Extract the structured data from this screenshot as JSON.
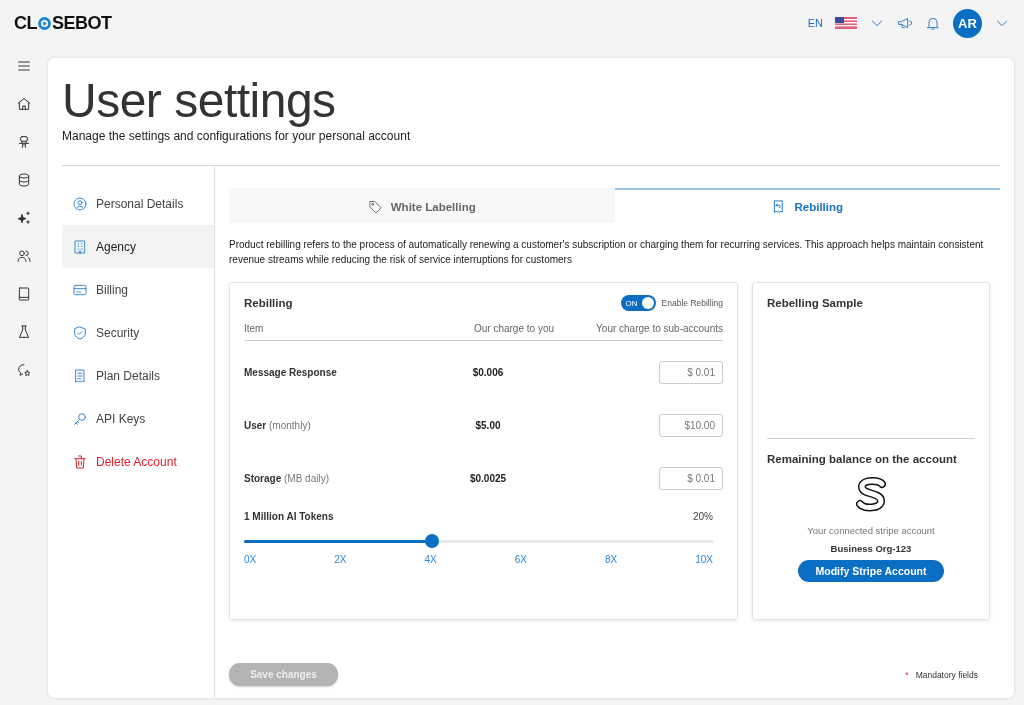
{
  "header": {
    "logo": {
      "left": "CL",
      "right": "SEBOT"
    },
    "language": "EN",
    "avatar": "AR"
  },
  "page": {
    "title": "User settings",
    "subtitle": "Manage the settings and configurations for your personal account"
  },
  "nav": [
    {
      "label": "Personal Details",
      "selected": false,
      "kind": "normal"
    },
    {
      "label": "Agency",
      "selected": true,
      "kind": "normal"
    },
    {
      "label": "Billing",
      "selected": false,
      "kind": "normal"
    },
    {
      "label": "Security",
      "selected": false,
      "kind": "normal"
    },
    {
      "label": "Plan Details",
      "selected": false,
      "kind": "normal"
    },
    {
      "label": "API Keys",
      "selected": false,
      "kind": "normal"
    },
    {
      "label": "Delete Account",
      "selected": false,
      "kind": "danger"
    }
  ],
  "tabs": [
    {
      "label": "White Labelling",
      "selected": false
    },
    {
      "label": "Rebilling",
      "selected": true
    }
  ],
  "description": "Product rebilling refers to the process of automatically renewing a customer's subscription or charging them for recurring services. This approach helps maintain consistent revenue streams while reducing the risk of service interruptions for customers",
  "rebilling": {
    "title": "Rebilling",
    "toggle": {
      "on": true,
      "text": "ON",
      "label": "Enable Rebilling"
    },
    "columns": [
      "Item",
      "Our charge to you",
      "Your charge to sub-accounts"
    ],
    "rows": [
      {
        "name": "Message Response",
        "our_charge": "$0.006",
        "your_charge": "$ 0.01"
      },
      {
        "name": "User",
        "unit": "(monthly)",
        "our_charge": "$5.00",
        "your_charge": "$10.00"
      },
      {
        "name": "Storage",
        "unit": "(MB daily)",
        "our_charge": "$0.0025",
        "your_charge": "$ 0.01"
      }
    ],
    "tokens": {
      "label": "1 Million AI Tokens",
      "reading": "20%",
      "level": 0.4,
      "ticks": [
        "0X",
        "2X",
        "4X",
        "6X",
        "8X",
        "10X"
      ]
    }
  },
  "sample": {
    "title": "Rebelling Sample",
    "balance_title": "Remaining balance on the account",
    "stripe_caption": "Your connected stripe account",
    "account_name": "Business Org-123",
    "button": "Modify Stripe Account"
  },
  "footer": {
    "save": {
      "label": "Save changes",
      "disabled": true
    },
    "mandatory": {
      "mark": "*",
      "text": "Mandatory fields"
    }
  }
}
